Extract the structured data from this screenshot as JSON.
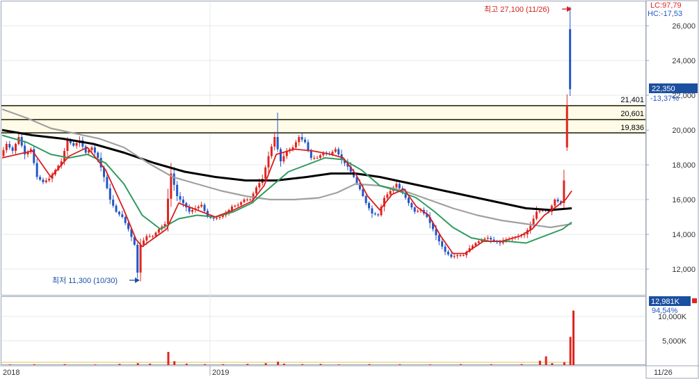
{
  "chart_data": {
    "type": "candlestick",
    "colors": {
      "up": "#e0251f",
      "down": "#2356c8",
      "ma5": "#d81e1e",
      "ma20": "#2e9a5e",
      "ma60": "#a0a0a0",
      "ma120": "#000000",
      "price_box": "#1b4fa0"
    },
    "price_axis": {
      "ylim": [
        10000,
        28000
      ],
      "ticks": [
        "26,000",
        "24,000",
        "22,000",
        "20,000",
        "18,000",
        "16,000",
        "14,000",
        "12,000"
      ],
      "tick_values": [
        26000,
        24000,
        22000,
        20000,
        18000,
        16000,
        14000,
        12000
      ]
    },
    "volume_axis": {
      "ticks": [
        "10,000K",
        "5,000K"
      ],
      "tick_values": [
        10000,
        5000
      ],
      "unit": "K"
    },
    "x_ticks": [
      "2018",
      "2019"
    ],
    "current_date": "11/26",
    "indicators": {
      "lc": "LC:97,79",
      "hc": "HC:-17,53"
    },
    "current_price": {
      "value": "22,350",
      "change": "-13,37%"
    },
    "current_volume": {
      "value": "12,981K",
      "change": "94,54%"
    },
    "levels": [
      {
        "value": 21401,
        "label": "21,401"
      },
      {
        "value": 20601,
        "label": "20,601"
      },
      {
        "value": 19836,
        "label": "19,836"
      }
    ],
    "annotations": {
      "high": "최고 27,100 (11/26)",
      "low": "최저 11,300 (10/30)"
    },
    "series": [
      {
        "name": "price_path",
        "points": [
          [
            0,
            18500
          ],
          [
            2,
            19200
          ],
          [
            4,
            18800
          ],
          [
            6,
            19600
          ],
          [
            8,
            18600
          ],
          [
            10,
            18900
          ],
          [
            12,
            17300
          ],
          [
            14,
            17000
          ],
          [
            16,
            17200
          ],
          [
            18,
            17700
          ],
          [
            20,
            18200
          ],
          [
            22,
            19400
          ],
          [
            24,
            19100
          ],
          [
            26,
            19400
          ],
          [
            28,
            18700
          ],
          [
            30,
            19000
          ],
          [
            32,
            18400
          ],
          [
            34,
            17300
          ],
          [
            36,
            16000
          ],
          [
            38,
            15300
          ],
          [
            40,
            15000
          ],
          [
            42,
            14300
          ],
          [
            44,
            13400
          ],
          [
            45,
            11800
          ],
          [
            46,
            13400
          ],
          [
            48,
            13900
          ],
          [
            50,
            13900
          ],
          [
            52,
            14300
          ],
          [
            54,
            14600
          ],
          [
            56,
            17500
          ],
          [
            58,
            16200
          ],
          [
            60,
            15800
          ],
          [
            62,
            15300
          ],
          [
            64,
            15500
          ],
          [
            66,
            15700
          ],
          [
            68,
            15000
          ],
          [
            70,
            14900
          ],
          [
            72,
            15000
          ],
          [
            74,
            15200
          ],
          [
            76,
            15600
          ],
          [
            78,
            15700
          ],
          [
            80,
            16000
          ],
          [
            82,
            16000
          ],
          [
            84,
            16700
          ],
          [
            86,
            17200
          ],
          [
            88,
            18500
          ],
          [
            90,
            19600
          ],
          [
            92,
            18200
          ],
          [
            94,
            18800
          ],
          [
            96,
            19000
          ],
          [
            98,
            19600
          ],
          [
            100,
            19300
          ],
          [
            102,
            18400
          ],
          [
            104,
            18400
          ],
          [
            106,
            18700
          ],
          [
            108,
            18600
          ],
          [
            110,
            18900
          ],
          [
            112,
            18300
          ],
          [
            114,
            17900
          ],
          [
            116,
            17300
          ],
          [
            118,
            16600
          ],
          [
            120,
            15800
          ],
          [
            122,
            15200
          ],
          [
            124,
            15100
          ],
          [
            126,
            16100
          ],
          [
            128,
            16500
          ],
          [
            130,
            16900
          ],
          [
            132,
            16400
          ],
          [
            134,
            15800
          ],
          [
            136,
            15300
          ],
          [
            138,
            15400
          ],
          [
            140,
            15000
          ],
          [
            142,
            14300
          ],
          [
            144,
            13600
          ],
          [
            146,
            13000
          ],
          [
            148,
            12700
          ],
          [
            150,
            12800
          ],
          [
            152,
            12800
          ],
          [
            154,
            13200
          ],
          [
            156,
            13500
          ],
          [
            158,
            13700
          ],
          [
            160,
            13800
          ],
          [
            162,
            13600
          ],
          [
            164,
            13500
          ],
          [
            166,
            13700
          ],
          [
            168,
            13800
          ],
          [
            170,
            13900
          ],
          [
            172,
            14000
          ],
          [
            174,
            14500
          ],
          [
            176,
            15300
          ],
          [
            178,
            15400
          ],
          [
            180,
            15300
          ],
          [
            182,
            16000
          ],
          [
            184,
            15800
          ],
          [
            186,
            18400
          ],
          [
            187,
            22350
          ]
        ]
      },
      {
        "name": "ma5",
        "points": [
          [
            0,
            18400
          ],
          [
            10,
            18800
          ],
          [
            16,
            17300
          ],
          [
            22,
            18500
          ],
          [
            28,
            19000
          ],
          [
            34,
            17700
          ],
          [
            40,
            15400
          ],
          [
            44,
            13700
          ],
          [
            46,
            13300
          ],
          [
            50,
            13800
          ],
          [
            54,
            14300
          ],
          [
            58,
            15800
          ],
          [
            64,
            15400
          ],
          [
            70,
            15000
          ],
          [
            76,
            15400
          ],
          [
            82,
            15900
          ],
          [
            86,
            16800
          ],
          [
            90,
            18600
          ],
          [
            96,
            18900
          ],
          [
            102,
            18800
          ],
          [
            108,
            18600
          ],
          [
            112,
            18400
          ],
          [
            116,
            17500
          ],
          [
            120,
            16200
          ],
          [
            124,
            15400
          ],
          [
            128,
            16300
          ],
          [
            132,
            16600
          ],
          [
            136,
            15600
          ],
          [
            140,
            15100
          ],
          [
            144,
            13900
          ],
          [
            148,
            12900
          ],
          [
            152,
            12900
          ],
          [
            158,
            13600
          ],
          [
            164,
            13600
          ],
          [
            170,
            13900
          ],
          [
            174,
            14300
          ],
          [
            178,
            15100
          ],
          [
            182,
            15600
          ],
          [
            185,
            16000
          ],
          [
            187,
            16500
          ]
        ]
      },
      {
        "name": "ma20",
        "points": [
          [
            0,
            19700
          ],
          [
            8,
            19300
          ],
          [
            16,
            18600
          ],
          [
            22,
            18400
          ],
          [
            28,
            18600
          ],
          [
            34,
            18100
          ],
          [
            40,
            16900
          ],
          [
            46,
            15100
          ],
          [
            52,
            14300
          ],
          [
            58,
            14900
          ],
          [
            64,
            15100
          ],
          [
            70,
            15000
          ],
          [
            76,
            15300
          ],
          [
            82,
            15800
          ],
          [
            88,
            16700
          ],
          [
            94,
            17600
          ],
          [
            100,
            18000
          ],
          [
            106,
            18400
          ],
          [
            112,
            18300
          ],
          [
            118,
            17700
          ],
          [
            124,
            16800
          ],
          [
            130,
            16500
          ],
          [
            136,
            16100
          ],
          [
            142,
            15300
          ],
          [
            148,
            14400
          ],
          [
            154,
            13800
          ],
          [
            160,
            13600
          ],
          [
            166,
            13600
          ],
          [
            172,
            13500
          ],
          [
            178,
            13900
          ],
          [
            184,
            14300
          ],
          [
            187,
            14700
          ]
        ]
      },
      {
        "name": "ma60",
        "points": [
          [
            0,
            21200
          ],
          [
            8,
            20700
          ],
          [
            16,
            20100
          ],
          [
            24,
            19800
          ],
          [
            32,
            19500
          ],
          [
            40,
            19000
          ],
          [
            48,
            18100
          ],
          [
            56,
            17300
          ],
          [
            64,
            16900
          ],
          [
            72,
            16500
          ],
          [
            80,
            16200
          ],
          [
            88,
            16000
          ],
          [
            96,
            16000
          ],
          [
            104,
            16100
          ],
          [
            110,
            16400
          ],
          [
            116,
            16900
          ],
          [
            124,
            16800
          ],
          [
            132,
            16500
          ],
          [
            140,
            16000
          ],
          [
            148,
            15500
          ],
          [
            156,
            15100
          ],
          [
            164,
            14800
          ],
          [
            172,
            14600
          ],
          [
            180,
            14400
          ],
          [
            187,
            14600
          ]
        ]
      },
      {
        "name": "ma120",
        "points": [
          [
            0,
            20000
          ],
          [
            10,
            19700
          ],
          [
            20,
            19500
          ],
          [
            30,
            19200
          ],
          [
            40,
            18700
          ],
          [
            50,
            18100
          ],
          [
            60,
            17600
          ],
          [
            70,
            17300
          ],
          [
            80,
            17100
          ],
          [
            90,
            17100
          ],
          [
            100,
            17300
          ],
          [
            108,
            17500
          ],
          [
            116,
            17500
          ],
          [
            124,
            17300
          ],
          [
            132,
            17000
          ],
          [
            140,
            16700
          ],
          [
            148,
            16400
          ],
          [
            156,
            16100
          ],
          [
            164,
            15800
          ],
          [
            172,
            15500
          ],
          [
            180,
            15400
          ],
          [
            187,
            15500
          ]
        ]
      }
    ],
    "volume": [
      [
        2,
        150
      ],
      [
        10,
        180
      ],
      [
        20,
        200
      ],
      [
        30,
        150
      ],
      [
        38,
        250
      ],
      [
        44,
        400
      ],
      [
        48,
        300
      ],
      [
        54,
        2700
      ],
      [
        56,
        800
      ],
      [
        60,
        300
      ],
      [
        66,
        200
      ],
      [
        72,
        200
      ],
      [
        80,
        250
      ],
      [
        86,
        400
      ],
      [
        90,
        700
      ],
      [
        92,
        300
      ],
      [
        98,
        200
      ],
      [
        104,
        250
      ],
      [
        110,
        150
      ],
      [
        120,
        200
      ],
      [
        130,
        180
      ],
      [
        140,
        150
      ],
      [
        150,
        200
      ],
      [
        160,
        180
      ],
      [
        170,
        200
      ],
      [
        176,
        900
      ],
      [
        178,
        1800
      ],
      [
        180,
        400
      ],
      [
        184,
        600
      ],
      [
        186,
        5800
      ],
      [
        187,
        11200
      ]
    ]
  }
}
